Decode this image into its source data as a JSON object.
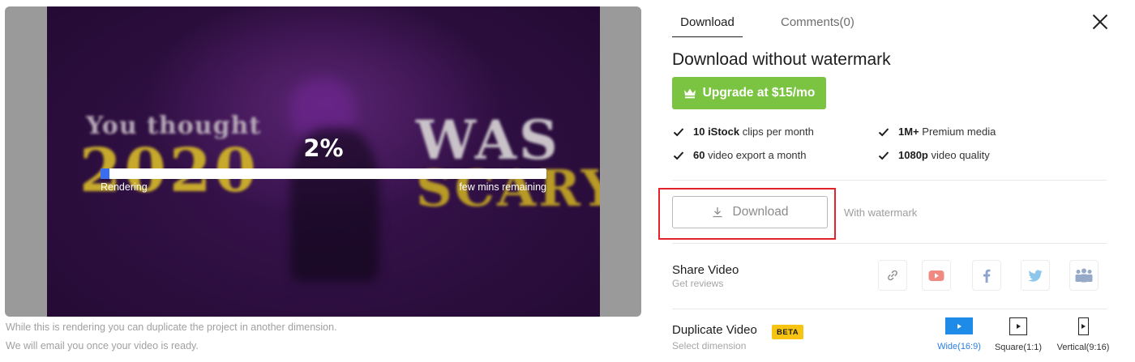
{
  "preview": {
    "video_text": {
      "line1": "You thought",
      "line2": "2020",
      "line3": "WAS",
      "line4": "SCARY?"
    },
    "progress": {
      "percent_label": "2%",
      "percent_value": 2,
      "status": "Rendering",
      "remaining": "few mins remaining",
      "fill_color": "#3b6df0"
    },
    "notes": [
      "While this is rendering you can duplicate the project in another dimension.",
      "We will email you once your video is ready."
    ]
  },
  "panel": {
    "tabs": [
      {
        "label": "Download",
        "active": true
      },
      {
        "label": "Comments(0)",
        "active": false
      }
    ],
    "close_icon": "close-icon",
    "title": "Download without watermark",
    "upgrade": {
      "label": "Upgrade at $15/mo",
      "icon": "crown-icon",
      "color": "#7bc441"
    },
    "features": [
      {
        "strong": "10 iStock",
        "rest": "clips per month"
      },
      {
        "strong": "60",
        "rest": "video export a month"
      },
      {
        "strong": "1M+",
        "rest": "Premium media"
      },
      {
        "strong": "1080p",
        "rest": "video quality"
      }
    ],
    "download": {
      "label": "Download",
      "icon": "download-icon",
      "note": "With watermark",
      "highlight_color": "#e3242b"
    },
    "share": {
      "title": "Share Video",
      "subtitle": "Get reviews",
      "buttons": [
        {
          "icon": "link-icon"
        },
        {
          "icon": "youtube-icon"
        },
        {
          "icon": "facebook-icon"
        },
        {
          "icon": "twitter-icon"
        },
        {
          "icon": "team-icon"
        }
      ]
    },
    "duplicate": {
      "title": "Duplicate Video",
      "badge": "BETA",
      "subtitle": "Select dimension",
      "dimensions": [
        {
          "label": "Wide(16:9)",
          "active": true
        },
        {
          "label": "Square(1:1)",
          "active": false
        },
        {
          "label": "Vertical(9:16)",
          "active": false
        }
      ]
    }
  }
}
